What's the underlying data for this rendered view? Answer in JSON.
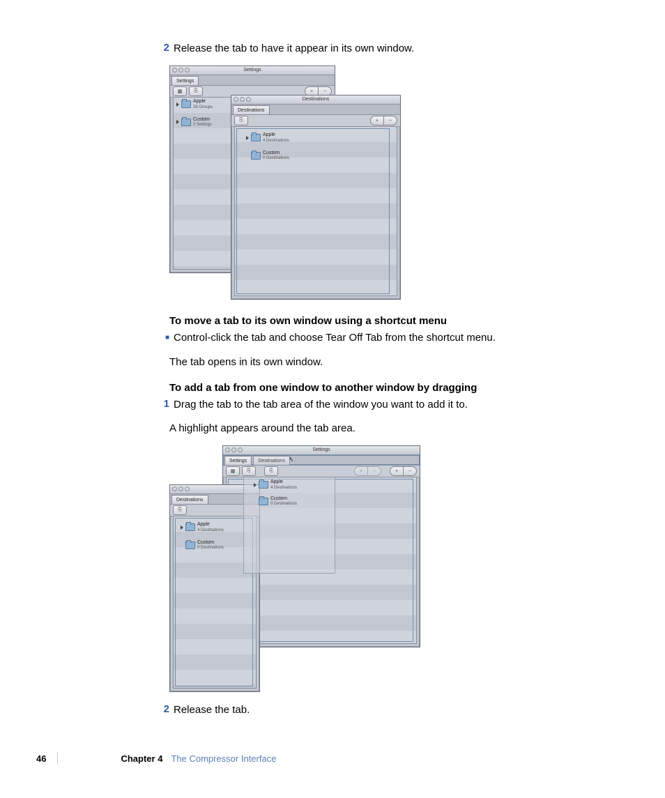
{
  "steps": {
    "s2a_num": "2",
    "s2a": "Release the tab to have it appear in its own window.",
    "h1": "To move a tab to its own window using a shortcut menu",
    "b1": "Control-click the tab and choose Tear Off Tab from the shortcut menu.",
    "p1": "The tab opens in its own window.",
    "h2": "To add a tab from one window to another window by dragging",
    "s1_num": "1",
    "s1": "Drag the tab to the tab area of the window you want to add it to.",
    "p2": "A highlight appears around the tab area.",
    "s2b_num": "2",
    "s2b": "Release the tab."
  },
  "fig1": {
    "win1": {
      "title": "Settings",
      "tab": "Settings",
      "items": [
        {
          "name": "Apple",
          "sub": "26 Groups",
          "disclose": true
        },
        {
          "name": "Custom",
          "sub": "2 Settings",
          "disclose": true
        }
      ]
    },
    "win2": {
      "title": "Destinations",
      "tab": "Destinations",
      "items": [
        {
          "name": "Apple",
          "sub": "4 Destinations",
          "disclose": true
        },
        {
          "name": "Custom",
          "sub": "0 Destinations",
          "disclose": false
        }
      ]
    }
  },
  "fig2": {
    "win1": {
      "title": "Settings",
      "tab1": "Settings",
      "tab2": "Destinations",
      "items": [
        {
          "name": "Apple",
          "sub": "4 Destinations",
          "disclose": true
        },
        {
          "name": "Custom",
          "sub": "0 Destinations",
          "disclose": false
        }
      ]
    },
    "win2": {
      "title": "",
      "tab": "Destinations",
      "items": [
        {
          "name": "Apple",
          "sub": "4 Destinations",
          "disclose": true
        },
        {
          "name": "Custom",
          "sub": "0 Destinations",
          "disclose": false
        }
      ]
    }
  },
  "footer": {
    "page": "46",
    "chapter": "Chapter 4",
    "title": "The Compressor Interface"
  },
  "icons": {
    "plus": "+",
    "minus": "−",
    "dup": "⎘",
    "new": "▦"
  }
}
